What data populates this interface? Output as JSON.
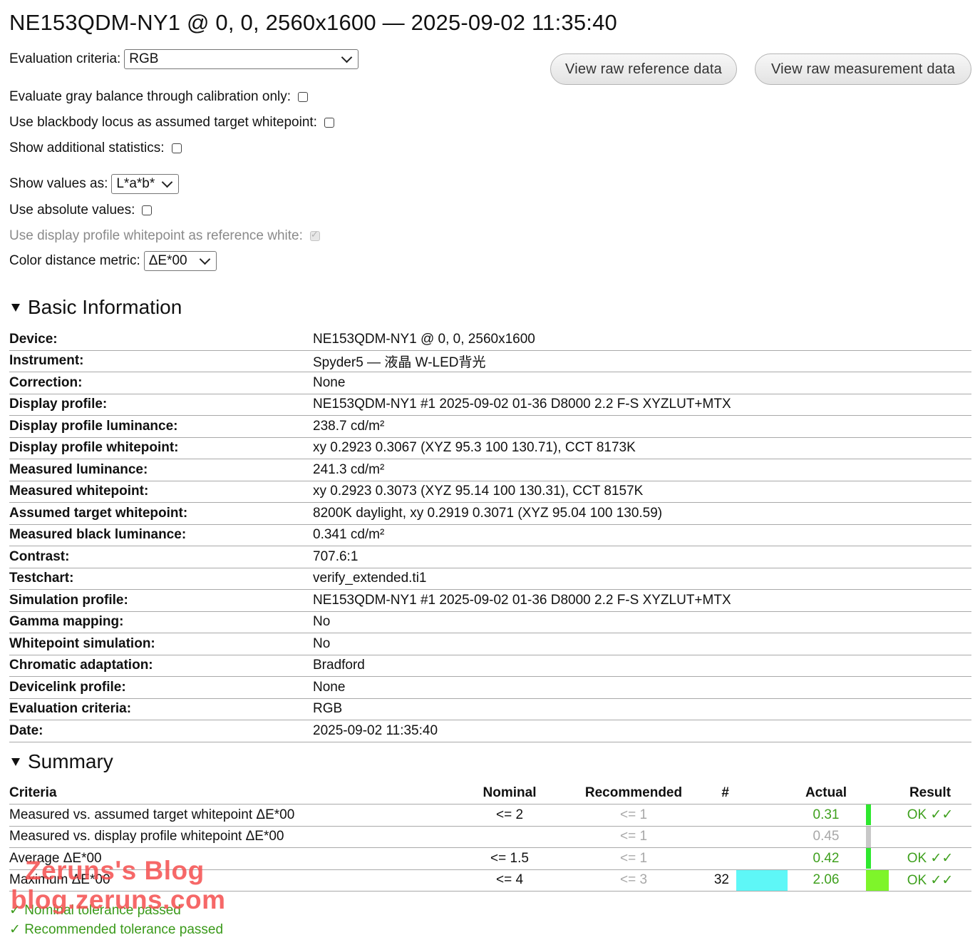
{
  "title": "NE153QDM-NY1 @ 0, 0, 2560x1600 — 2025-09-02 11:35:40",
  "controls": {
    "eval_label": "Evaluation criteria:",
    "eval_value": "RGB",
    "gray_balance_label": "Evaluate gray balance through calibration only:",
    "blackbody_label": "Use blackbody locus as assumed target whitepoint:",
    "additional_stats_label": "Show additional statistics:",
    "show_values_label": "Show values as:",
    "show_values_value": "L*a*b*",
    "absolute_label": "Use absolute values:",
    "profile_white_label": "Use display profile whitepoint as reference white:",
    "metric_label": "Color distance metric:",
    "metric_value": "ΔE*00"
  },
  "buttons": {
    "raw_reference": "View raw reference data",
    "raw_measurement": "View raw measurement data"
  },
  "basic_info": {
    "heading": "Basic Information",
    "rows": [
      {
        "k": "Device:",
        "v": "NE153QDM-NY1 @ 0, 0, 2560x1600"
      },
      {
        "k": "Instrument:",
        "v": "Spyder5 — 液晶 W-LED背光"
      },
      {
        "k": "Correction:",
        "v": "None"
      },
      {
        "k": "Display profile:",
        "v": "NE153QDM-NY1 #1 2025-09-02 01-36 D8000 2.2 F-S XYZLUT+MTX"
      },
      {
        "k": "Display profile luminance:",
        "v": "238.7 cd/m²"
      },
      {
        "k": "Display profile whitepoint:",
        "v": "xy 0.2923 0.3067 (XYZ 95.3 100 130.71), CCT 8173K"
      },
      {
        "k": "Measured luminance:",
        "v": "241.3 cd/m²"
      },
      {
        "k": "Measured whitepoint:",
        "v": "xy 0.2923 0.3073 (XYZ 95.14 100 130.31), CCT 8157K"
      },
      {
        "k": "Assumed target whitepoint:",
        "v": "8200K daylight, xy 0.2919 0.3071 (XYZ 95.04 100 130.59)"
      },
      {
        "k": "Measured black luminance:",
        "v": "0.341 cd/m²"
      },
      {
        "k": "Contrast:",
        "v": "707.6:1"
      },
      {
        "k": "Testchart:",
        "v": "verify_extended.ti1"
      },
      {
        "k": "Simulation profile:",
        "v": "NE153QDM-NY1 #1 2025-09-02 01-36 D8000 2.2 F-S XYZLUT+MTX"
      },
      {
        "k": "Gamma mapping:",
        "v": "No"
      },
      {
        "k": "Whitepoint simulation:",
        "v": "No"
      },
      {
        "k": "Chromatic adaptation:",
        "v": "Bradford"
      },
      {
        "k": "Devicelink profile:",
        "v": "None"
      },
      {
        "k": "Evaluation criteria:",
        "v": "RGB"
      },
      {
        "k": "Date:",
        "v": "2025-09-02 11:35:40"
      }
    ]
  },
  "summary": {
    "heading": "Summary",
    "headers": {
      "criteria": "Criteria",
      "nominal": "Nominal",
      "recommended": "Recommended",
      "num": "#",
      "actual": "Actual",
      "result": "Result"
    },
    "rows": [
      {
        "criteria": "Measured vs. assumed target whitepoint ΔE*00",
        "nominal": "<= 2",
        "recommended": "<= 1",
        "num": "",
        "actual": "0.31",
        "result": "OK ✓✓",
        "bar_color": "#2ee82e",
        "bar_level": 0.15,
        "swatch": ""
      },
      {
        "criteria": "Measured vs. display profile whitepoint ΔE*00",
        "nominal": "",
        "recommended": "<= 1",
        "num": "",
        "actual": "0.45",
        "result": "",
        "bar_color": "#c8c8c8",
        "bar_level": 0.22,
        "swatch": ""
      },
      {
        "criteria": "Average ΔE*00",
        "nominal": "<= 1.5",
        "recommended": "<= 1",
        "num": "",
        "actual": "0.42",
        "result": "OK ✓✓",
        "bar_color": "#2ee82e",
        "bar_level": 0.2,
        "swatch": ""
      },
      {
        "criteria": "Maximum ΔE*00",
        "nominal": "<= 4",
        "recommended": "<= 3",
        "num": "32",
        "actual": "2.06",
        "result": "OK ✓✓",
        "bar_color": "#7ef52a",
        "bar_level": 1.0,
        "swatch": "#5ef7f7"
      }
    ],
    "legend": [
      "✓ Nominal tolerance passed",
      "✓ Recommended tolerance passed"
    ]
  },
  "watermark": {
    "line1": "Zeruns's Blog",
    "line2": "blog.zeruns.com"
  }
}
